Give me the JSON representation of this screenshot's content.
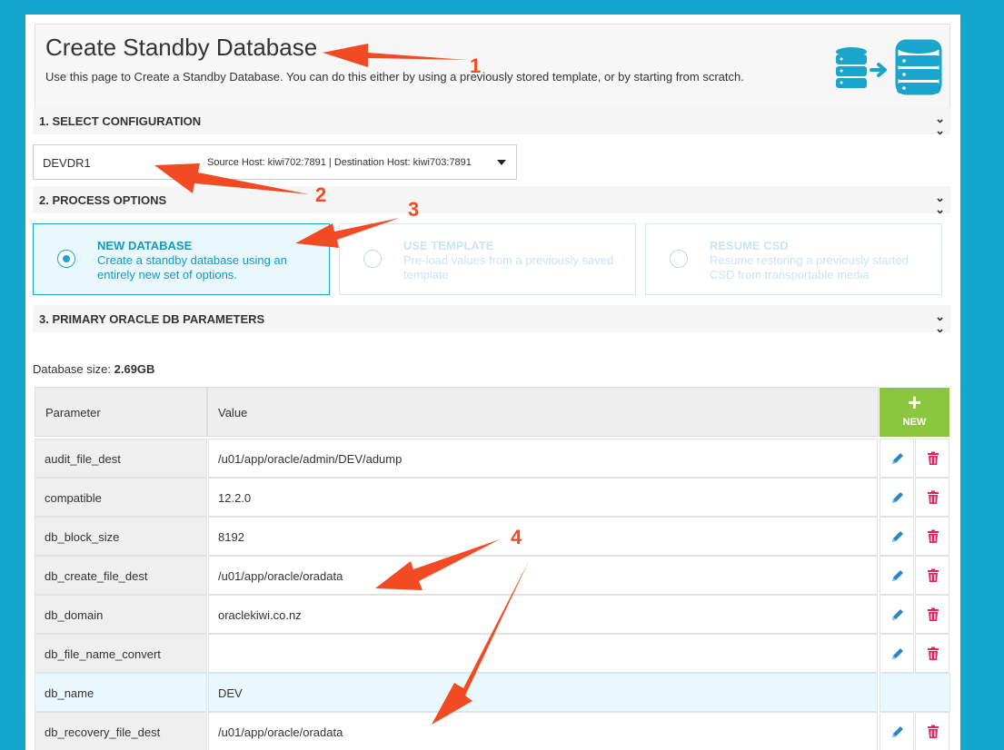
{
  "header": {
    "title": "Create Standby Database",
    "description": "Use this page to Create a Standby Database. You can do this either by using a previously stored template, or by starting from scratch.",
    "graphic_icon": "database-transfer-icon"
  },
  "sections": {
    "select_configuration": "1. SELECT CONFIGURATION",
    "process_options": "2. PROCESS OPTIONS",
    "primary_params": "3. PRIMARY ORACLE DB PARAMETERS"
  },
  "configuration": {
    "name": "DEVDR1",
    "hosts": "Source Host: kiwi702:7891 | Destination Host: kiwi703:7891"
  },
  "options": [
    {
      "title": "NEW DATABASE",
      "description": "Create a standby database using an entirely new set of options.",
      "selected": true
    },
    {
      "title": "USE TEMPLATE",
      "description": "Pre-load values from a previously saved template",
      "selected": false
    },
    {
      "title": "RESUME CSD",
      "description": "Resume restoring a previously started CSD from transportable media",
      "selected": false
    }
  ],
  "database_size": {
    "label": "Database size:",
    "value": "2.69GB"
  },
  "table": {
    "headers": {
      "parameter": "Parameter",
      "value": "Value"
    },
    "new_button": {
      "plus": "+",
      "label": "NEW"
    },
    "rows": [
      {
        "parameter": "audit_file_dest",
        "value": "/u01/app/oracle/admin/DEV/adump"
      },
      {
        "parameter": "compatible",
        "value": "12.2.0"
      },
      {
        "parameter": "db_block_size",
        "value": "8192"
      },
      {
        "parameter": "db_create_file_dest",
        "value": "/u01/app/oracle/oradata"
      },
      {
        "parameter": "db_domain",
        "value": "oraclekiwi.co.nz"
      },
      {
        "parameter": "db_file_name_convert",
        "value": ""
      },
      {
        "parameter": "db_name",
        "value": "DEV"
      },
      {
        "parameter": "db_recovery_file_dest",
        "value": "/u01/app/oracle/oradata"
      }
    ]
  },
  "annotations": [
    "1",
    "2",
    "3",
    "4"
  ],
  "colors": {
    "background": "#13a7cf",
    "accent": "#1aa6cc",
    "new_button": "#8cc63f",
    "delete": "#e0245e",
    "edit": "#2a86c7",
    "arrow": "#f24a22"
  }
}
